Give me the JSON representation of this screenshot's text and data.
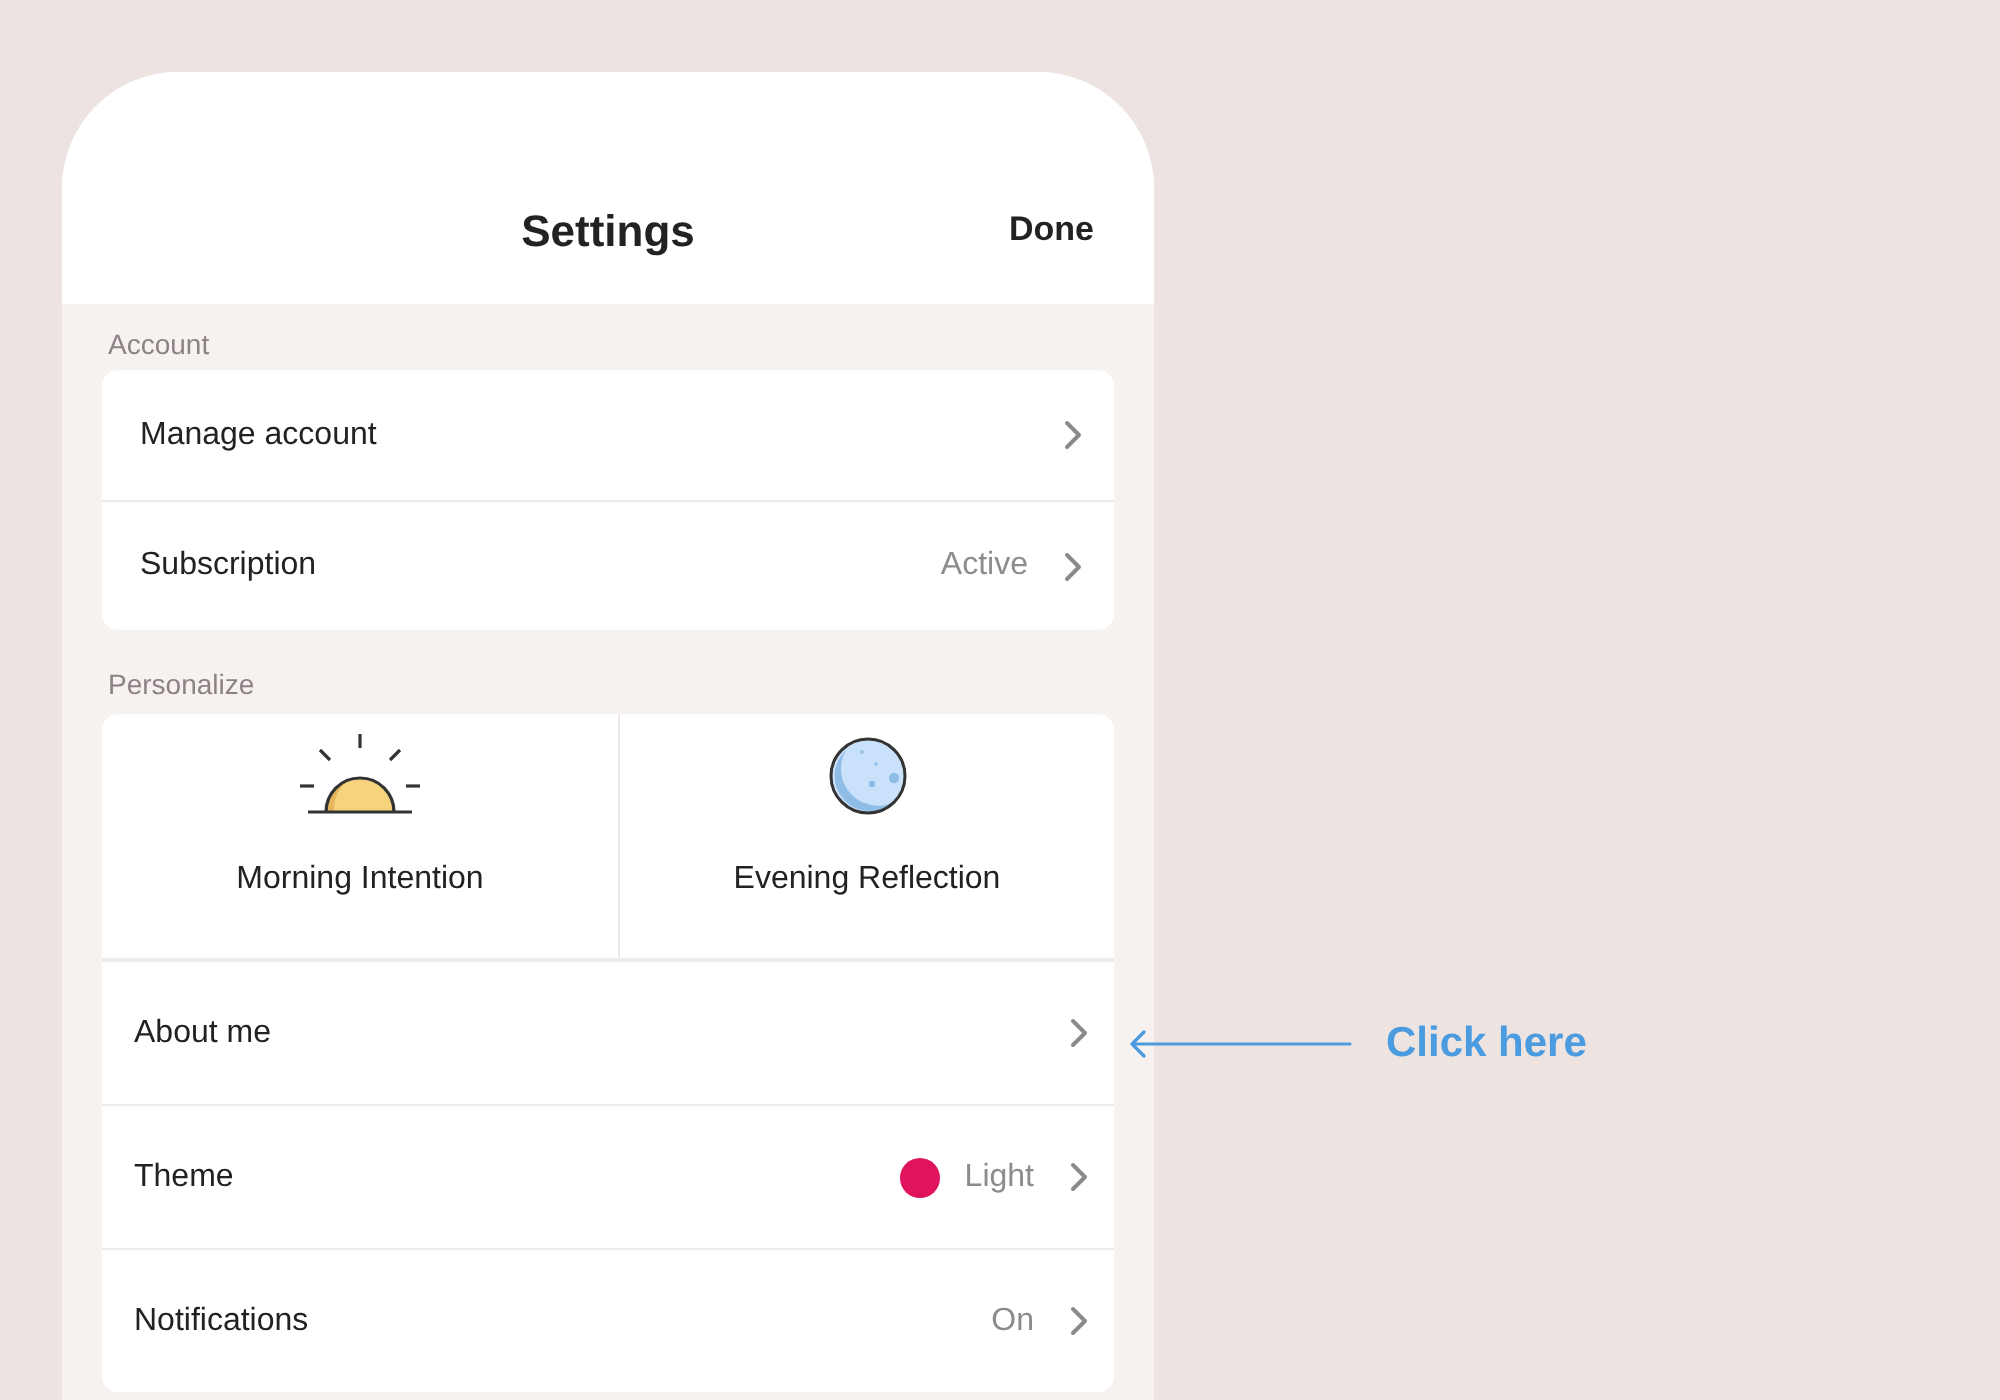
{
  "header": {
    "title": "Settings",
    "done": "Done"
  },
  "sections": [
    {
      "title": "Account",
      "rows": [
        {
          "label": "Manage account"
        },
        {
          "label": "Subscription",
          "value": "Active"
        }
      ]
    },
    {
      "title": "Personalize",
      "tiles": [
        {
          "label": "Morning Intention"
        },
        {
          "label": "Evening Reflection"
        }
      ],
      "rows": [
        {
          "label": "About me"
        },
        {
          "label": "Theme",
          "value": "Light",
          "color": "#e0135e"
        },
        {
          "label": "Notifications",
          "value": "On"
        }
      ]
    }
  ],
  "callout": {
    "text": "Click here"
  }
}
